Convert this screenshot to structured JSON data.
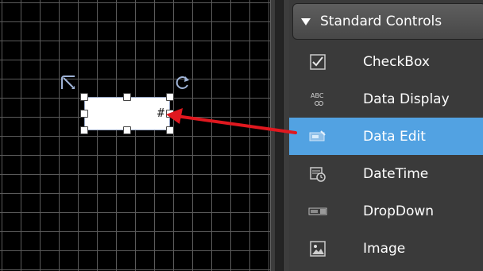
{
  "canvas": {
    "widget_symbol": "#"
  },
  "toolbox": {
    "category_title": "Standard Controls",
    "items": [
      {
        "label": "CheckBox",
        "icon": "checkbox-icon"
      },
      {
        "label": "Data Display",
        "icon": "data-display-icon",
        "icon_text": "ABC"
      },
      {
        "label": "Data Edit",
        "icon": "data-edit-icon",
        "selected": true
      },
      {
        "label": "DateTime",
        "icon": "datetime-icon"
      },
      {
        "label": "DropDown",
        "icon": "dropdown-icon"
      },
      {
        "label": "Image",
        "icon": "image-icon"
      }
    ]
  },
  "colors": {
    "canvas_bg": "#000000",
    "grid": "#5a5a5a",
    "panel_bg": "#3a3a3a",
    "selected": "#52a2e2",
    "arrow": "#e0181f"
  }
}
